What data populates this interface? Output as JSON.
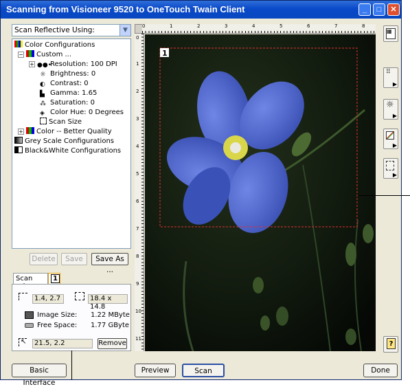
{
  "window": {
    "title": "Scanning from Visioneer 9520 to OneTouch Twain Client"
  },
  "scan_source": {
    "selected": "Scan Reflective Using:"
  },
  "tree": {
    "color_configurations": "Color Configurations",
    "custom": "Custom ...",
    "resolution": "Resolution: 100 DPI",
    "brightness": "Brightness: 0",
    "contrast": "Contrast: 0",
    "gamma": "Gamma: 1.65",
    "saturation": "Saturation: 0",
    "color_hue": "Color Hue: 0 Degrees",
    "scan_size": "Scan Size",
    "color_better": "Color -- Better Quality",
    "grey_scale": "Grey Scale Configurations",
    "black_white": "Black&White Configurations"
  },
  "config_buttons": {
    "delete": "Delete",
    "save": "Save",
    "save_as": "Save As ..."
  },
  "tabs": {
    "scan_info": "Scan Info",
    "region": "1"
  },
  "scan_info": {
    "position": "1.4, 2.7",
    "size": "18.4 x 14.8",
    "image_size_label": "Image Size:",
    "image_size_value": "1.22 MByte",
    "free_space_label": "Free Space:",
    "free_space_value": "1.77 GByte",
    "cursor_position": "21.5, 2.2",
    "remove": "Remove"
  },
  "ruler_top": [
    "0",
    "1",
    "2",
    "3",
    "4",
    "5",
    "6",
    "7",
    "8"
  ],
  "ruler_left": [
    "0",
    "1",
    "2",
    "3",
    "4",
    "5",
    "6",
    "7",
    "8",
    "9",
    "10",
    "11"
  ],
  "preview": {
    "region_label": "1"
  },
  "bottom": {
    "basic_interface": "Basic Interface",
    "preview": "Preview",
    "scan": "Scan",
    "done": "Done"
  },
  "colors": {
    "title_bar": "#0a49c8",
    "selection_border": "#e03030",
    "flower": "#4a63c9"
  }
}
